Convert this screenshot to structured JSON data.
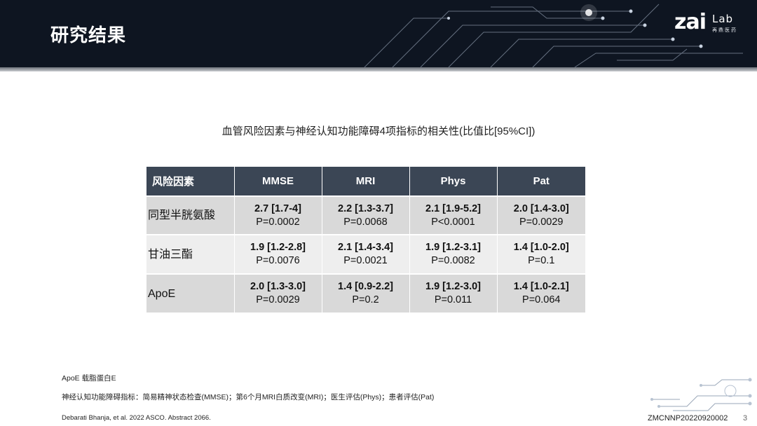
{
  "header": {
    "title": "研究结果",
    "logo_main": "zai",
    "logo_sub": "Lab",
    "logo_cn": "再鼎医药"
  },
  "subtitle": "血管风险因素与神经认知功能障碍4项指标的相关性(比值比[95%CI])",
  "table": {
    "headers": [
      "风险因素",
      "MMSE",
      "MRI",
      "Phys",
      "Pat"
    ],
    "rows": [
      {
        "factor": "同型半胱氨酸",
        "cells": [
          {
            "ci": "2.7 [1.7-4]",
            "p": "P=0.0002"
          },
          {
            "ci": "2.2 [1.3-3.7]",
            "p": "P=0.0068"
          },
          {
            "ci": "2.1 [1.9-5.2]",
            "p": "P<0.0001"
          },
          {
            "ci": "2.0 [1.4-3.0]",
            "p": "P=0.0029"
          }
        ]
      },
      {
        "factor": "甘油三酯",
        "cells": [
          {
            "ci": "1.9 [1.2-2.8]",
            "p": "P=0.0076"
          },
          {
            "ci": "2.1 [1.4-3.4]",
            "p": "P=0.0021"
          },
          {
            "ci": "1.9 [1.2-3.1]",
            "p": "P=0.0082"
          },
          {
            "ci": "1.4 [1.0-2.0]",
            "p": "P=0.1"
          }
        ]
      },
      {
        "factor": "ApoE",
        "cells": [
          {
            "ci": "2.0 [1.3-3.0]",
            "p": "P=0.0029"
          },
          {
            "ci": "1.4 [0.9-2.2]",
            "p": "P=0.2"
          },
          {
            "ci": "1.9 [1.2-3.0]",
            "p": "P=0.011"
          },
          {
            "ci": "1.4 [1.0-2.1]",
            "p": "P=0.064"
          }
        ]
      }
    ]
  },
  "notes": {
    "apoe": "ApoE 载脂蛋白E",
    "indicators": "神经认知功能障碍指标：简易精神状态检查(MMSE)；第6个月MRI白质改变(MRI)；医生评估(Phys)；患者评估(Pat)",
    "reference": "Debarati Bhanja, et al. 2022 ASCO. Abstract 2066."
  },
  "footer": {
    "code": "ZMCNNP20220920002",
    "page": "3"
  },
  "colors": {
    "header_bg": "#0e1521",
    "table_header": "#3b4655",
    "row_dark": "#d9d9d9",
    "row_light": "#eeeeee"
  }
}
